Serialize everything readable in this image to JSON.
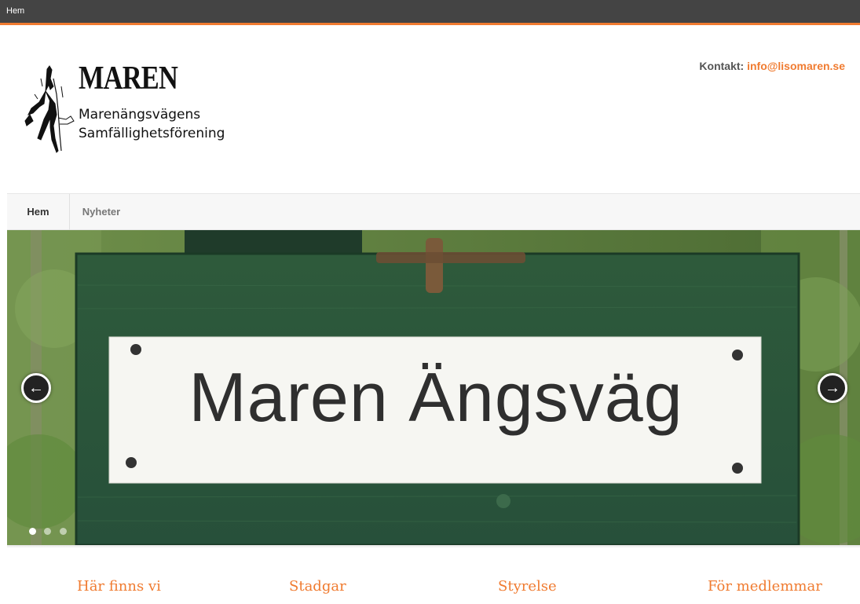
{
  "topbar": {
    "breadcrumb": "Hem"
  },
  "logo": {
    "title": "MAREN",
    "line1": "Marenängsvägens",
    "line2": "Samfällighetsförening"
  },
  "contact": {
    "label": "Kontakt:",
    "email": "info@lisomaren.se"
  },
  "nav": {
    "items": [
      {
        "label": "Hem"
      },
      {
        "label": "Nyheter"
      }
    ]
  },
  "hero": {
    "sign_text": "Maren Ängsväg",
    "arrow_left_icon": "arrow-left-icon",
    "arrow_right_icon": "arrow-right-icon",
    "slide_count": 3,
    "active_slide": 1
  },
  "bottom_links": [
    {
      "label": "Här finns vi"
    },
    {
      "label": "Stadgar"
    },
    {
      "label": "Styrelse"
    },
    {
      "label": "För medlemmar"
    }
  ],
  "colors": {
    "accent": "#f07b30",
    "topbar": "#444444",
    "sign_green": "#2f5a3a"
  }
}
